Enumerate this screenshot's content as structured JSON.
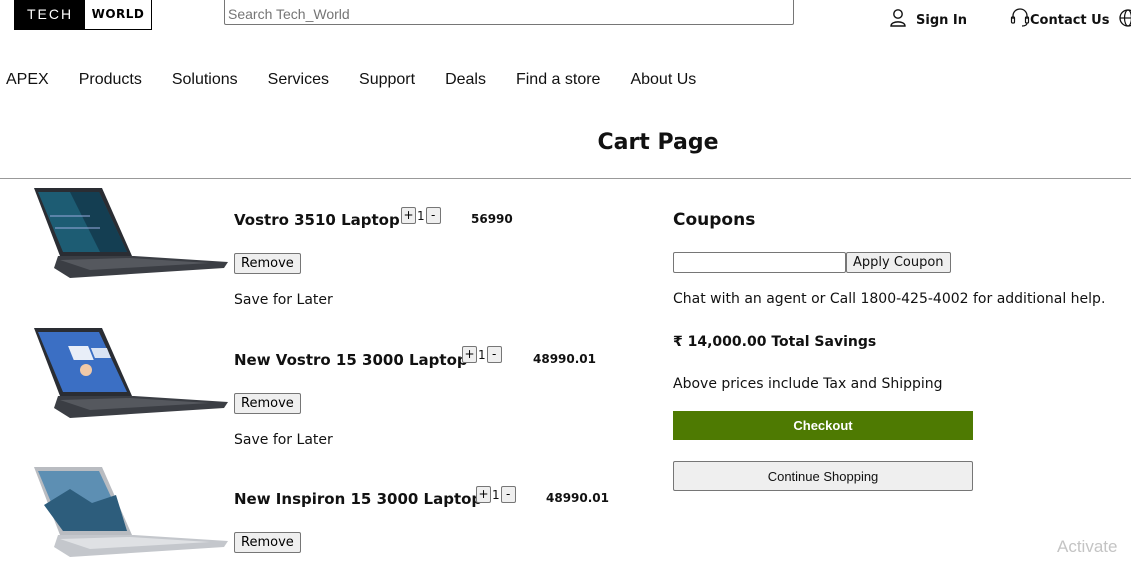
{
  "header": {
    "logo_left": "TECH",
    "logo_right": "WORLD",
    "search_placeholder": "Search Tech_World",
    "sign_in": "Sign In",
    "contact_us": "Contact Us"
  },
  "nav": {
    "items": [
      "APEX",
      "Products",
      "Solutions",
      "Services",
      "Support",
      "Deals",
      "Find a store",
      "About Us"
    ]
  },
  "page_title": "Cart Page",
  "cart": {
    "remove_label": "Remove",
    "save_later_label": "Save for Later",
    "items": [
      {
        "name": "Vostro 3510 Laptop",
        "qty": "1",
        "price": "56990"
      },
      {
        "name": "New Vostro 15 3000 Laptop",
        "qty": "1",
        "price": "48990.01"
      },
      {
        "name": "New Inspiron 15 3000 Laptop",
        "qty": "1",
        "price": "48990.01"
      }
    ],
    "plus": "+",
    "minus": "-"
  },
  "summary": {
    "coupons_title": "Coupons",
    "apply_coupon": "Apply Coupon",
    "coupon_value": "",
    "chat_text": "Chat with an agent or Call 1800-425-4002 for additional help.",
    "total_savings": "₹ 14,000.00 Total Savings",
    "tax_note": "Above prices include Tax and Shipping",
    "checkout": "Checkout",
    "continue_shopping": "Continue Shopping"
  },
  "watermark": "Activate",
  "colors": {
    "checkout_bg": "#4e7a02",
    "divider": "#999999"
  }
}
